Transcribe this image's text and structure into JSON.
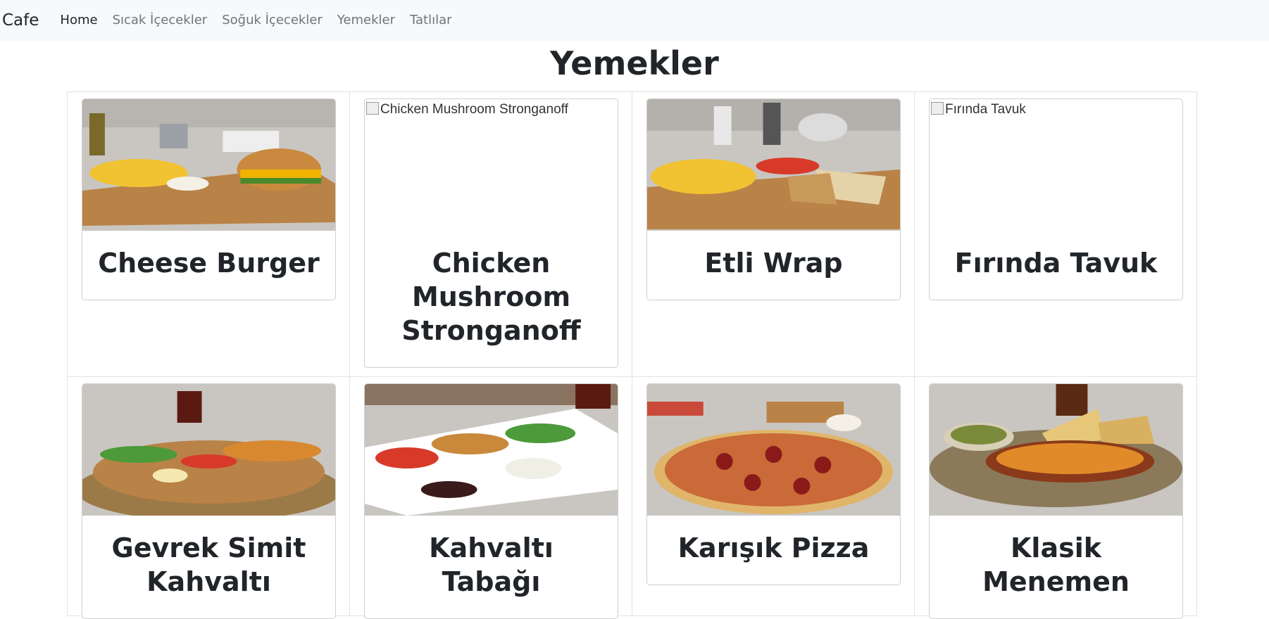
{
  "navbar": {
    "brand": "Cafe",
    "links": [
      {
        "label": "Home",
        "active": true
      },
      {
        "label": "Sıcak İçecekler",
        "active": false
      },
      {
        "label": "Soğuk İçecekler",
        "active": false
      },
      {
        "label": "Yemekler",
        "active": false
      },
      {
        "label": "Tatlılar",
        "active": false
      }
    ]
  },
  "page": {
    "title": "Yemekler"
  },
  "menu_items": [
    {
      "name": "Cheese Burger",
      "image_alt": "Cheese Burger",
      "image_loaded": true
    },
    {
      "name": "Chicken Mushroom Stronganoff",
      "image_alt": "Chicken Mushroom Stronganoff",
      "image_loaded": false
    },
    {
      "name": "Etli Wrap",
      "image_alt": "Etli Wrap",
      "image_loaded": true
    },
    {
      "name": "Fırında Tavuk",
      "image_alt": "Fırında Tavuk",
      "image_loaded": false
    },
    {
      "name": "Gevrek Simit Kahvaltı",
      "image_alt": "Gevrek Simit Kahvaltı",
      "image_loaded": true
    },
    {
      "name": "Kahvaltı Tabağı",
      "image_alt": "Kahvaltı Tabağı",
      "image_loaded": true
    },
    {
      "name": "Karışık Pizza",
      "image_alt": "Karışık Pizza",
      "image_loaded": true
    },
    {
      "name": "Klasik Menemen",
      "image_alt": "Klasik Menemen",
      "image_loaded": true
    }
  ],
  "colors": {
    "navbar_bg": "#f8f9fa",
    "nav_link": "#6c757d",
    "nav_active": "#212529",
    "table_wood": "#c7c4bf",
    "board_wood": "#b9844a"
  }
}
